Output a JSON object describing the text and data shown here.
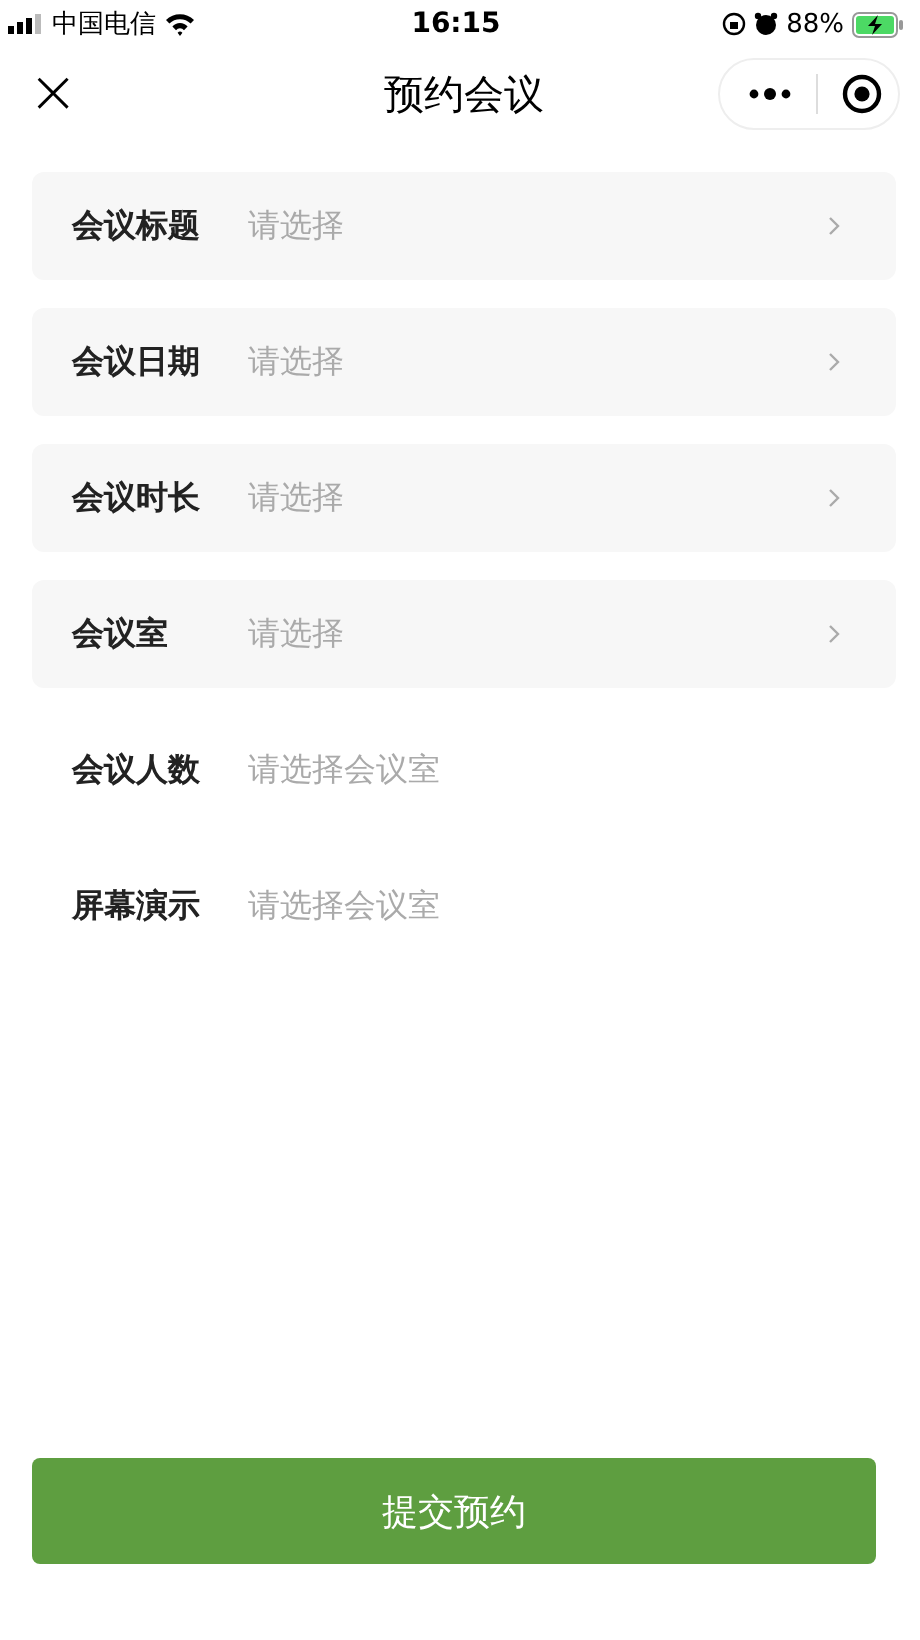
{
  "status_bar": {
    "carrier": "中国电信",
    "time": "16:15",
    "battery": "88%"
  },
  "nav": {
    "close": "×",
    "title": "预约会议"
  },
  "fields": [
    {
      "kind": "picker",
      "label": "会议标题",
      "placeholder": "请选择"
    },
    {
      "kind": "picker",
      "label": "会议日期",
      "placeholder": "请选择"
    },
    {
      "kind": "picker",
      "label": "会议时长",
      "placeholder": "请选择"
    },
    {
      "kind": "picker",
      "label": "会议室",
      "placeholder": "请选择"
    },
    {
      "kind": "info",
      "label": "会议人数",
      "placeholder": "请选择会议室"
    },
    {
      "kind": "info",
      "label": "屏幕演示",
      "placeholder": "请选择会议室"
    }
  ],
  "submit": "提交预约"
}
